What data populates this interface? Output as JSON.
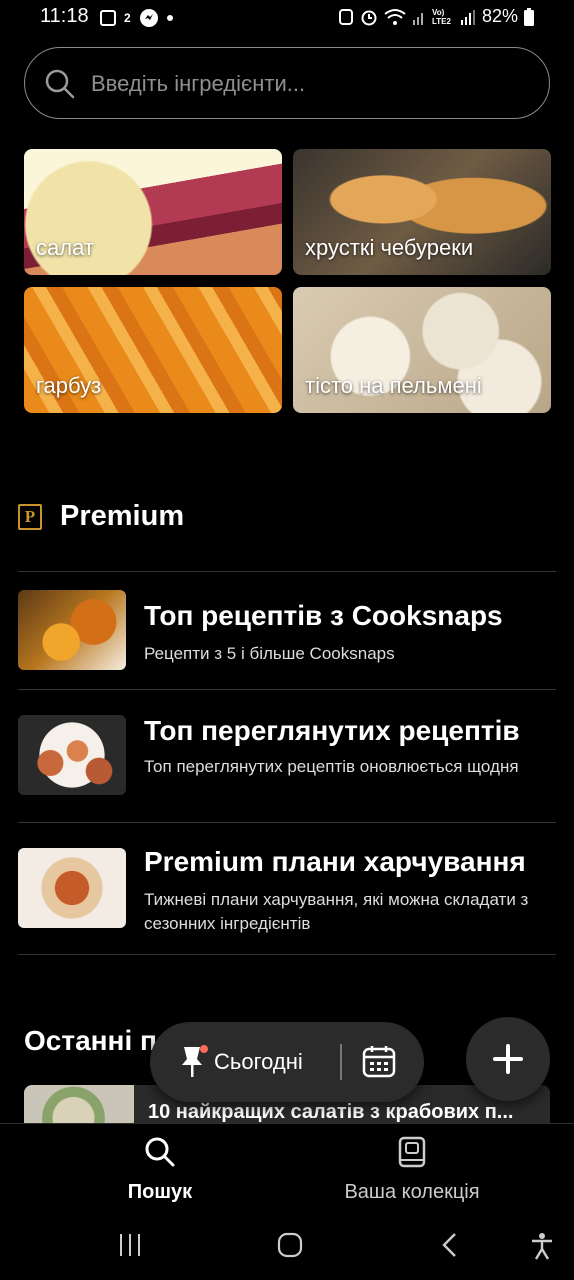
{
  "status_bar": {
    "time": "11:18",
    "small_indicator": "2",
    "network_label": "Vo) LTE2",
    "battery": "82%"
  },
  "search": {
    "placeholder": "Введіть інгредієнти..."
  },
  "categories": [
    {
      "label": "салат"
    },
    {
      "label": "хрусткі чебуреки"
    },
    {
      "label": "гарбуз"
    },
    {
      "label": "тісто на пельмені"
    }
  ],
  "premium": {
    "badge_letter": "P",
    "title": "Premium",
    "items": [
      {
        "title": "Топ рецептів з Cooksnaps",
        "subtitle": "Рецепти з 5 і більше Cooksnaps"
      },
      {
        "title": "Топ переглянутих рецептів",
        "subtitle": "Топ переглянутих рецептів оновлюється щодня"
      },
      {
        "title": "Premium плани харчування",
        "subtitle": "Тижневі плани харчування, які можна складати з сезонних інгредієнтів"
      }
    ]
  },
  "recent": {
    "title": "Останні п",
    "card_title": "10 найкращих салатів з крабових п..."
  },
  "floating": {
    "today_label": "Сьогодні"
  },
  "bottom_nav": {
    "search_label": "Пошук",
    "collection_label": "Ваша колекція"
  },
  "colors": {
    "background": "#000000",
    "premium_gold": "#c9952a",
    "floating_bg": "#2b2b2b",
    "notification_dot": "#ff6b5b"
  }
}
